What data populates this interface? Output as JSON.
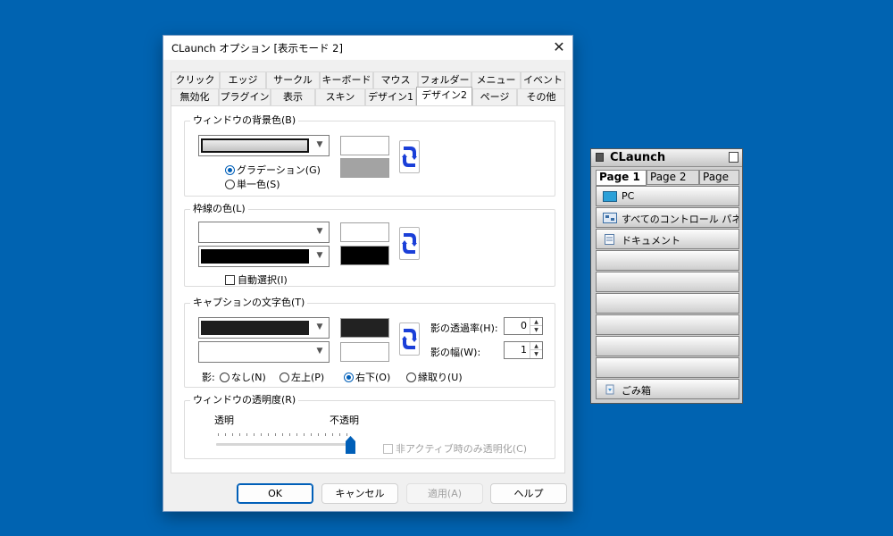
{
  "dialog": {
    "title": "CLaunch オプション [表示モード 2]",
    "close_glyph": "✕",
    "tabs_row1": [
      "クリック",
      "エッジ",
      "サークル",
      "キーボード",
      "マウス",
      "フォルダー",
      "メニュー",
      "イベント"
    ],
    "tabs_row2": [
      "無効化",
      "プラグイン",
      "表示",
      "スキン",
      "デザイン1",
      "デザイン2",
      "ページ",
      "その他"
    ],
    "active_tab": "デザイン2",
    "bg_group": {
      "legend": "ウィンドウの背景色(B)",
      "gradation_label": "グラデーション(G)",
      "single_label": "単一色(S)",
      "selected": "gradation"
    },
    "border_group": {
      "legend": "枠線の色(L)",
      "auto_select_label": "自動選択(I)"
    },
    "caption_group": {
      "legend": "キャプションの文字色(T)",
      "shadow_opacity_label": "影の透過率(H):",
      "shadow_opacity_value": "0",
      "shadow_width_label": "影の幅(W):",
      "shadow_width_value": "1",
      "shadow_label": "影:",
      "shadow_options": [
        "なし(N)",
        "左上(P)",
        "右下(O)",
        "縁取り(U)"
      ],
      "shadow_selected": "右下(O)"
    },
    "transparency_group": {
      "legend": "ウィンドウの透明度(R)",
      "transparent_label": "透明",
      "opaque_label": "不透明",
      "slider_level": 1.0,
      "inactive_only_label": "非アクティブ時のみ透明化(C)"
    },
    "buttons": {
      "ok": "OK",
      "cancel": "キャンセル",
      "apply": "適用(A)",
      "help": "ヘルプ"
    },
    "colors": {
      "desktop": "#0063b1",
      "accent": "#005fb8",
      "swap_arrow": "#1a3fd8"
    }
  },
  "claunch": {
    "title": "CLaunch",
    "tabs": [
      "Page 1",
      "Page 2",
      "Page"
    ],
    "active_tab": "Page 1",
    "items": [
      {
        "label": "PC",
        "icon": "monitor-icon"
      },
      {
        "label": "すべてのコントロール パネル",
        "icon": "control-panel-icon"
      },
      {
        "label": "ドキュメント",
        "icon": "document-icon"
      }
    ],
    "empty_slots": 6,
    "recycle": {
      "label": "ごみ箱",
      "icon": "recycle-bin-icon"
    }
  }
}
